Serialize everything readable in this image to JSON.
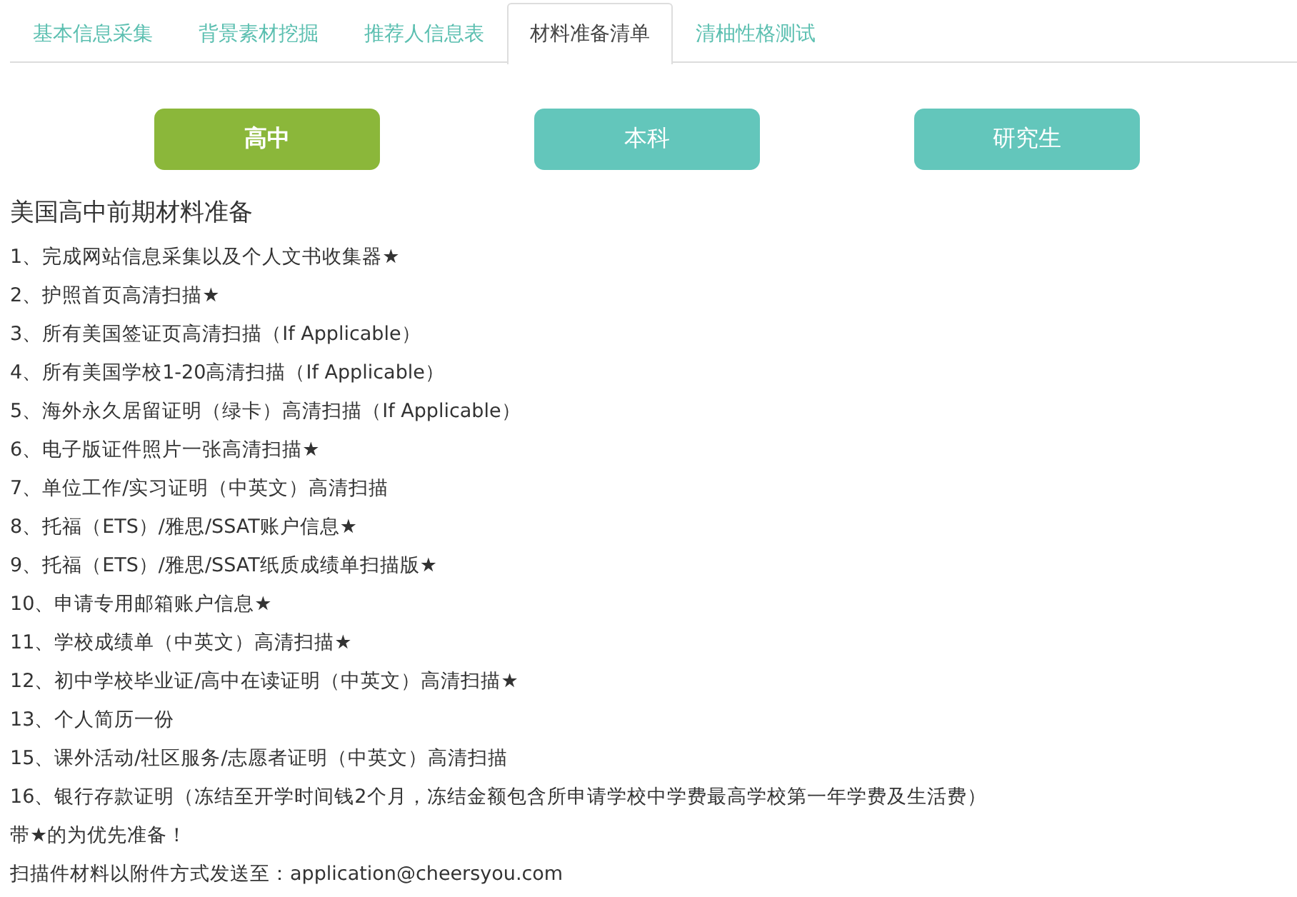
{
  "tabs": [
    {
      "label": "基本信息采集",
      "selected": false
    },
    {
      "label": "背景素材挖掘",
      "selected": false
    },
    {
      "label": "推荐人信息表",
      "selected": false
    },
    {
      "label": "材料准备清单",
      "selected": true
    },
    {
      "label": "清柚性格测试",
      "selected": false
    }
  ],
  "levels": [
    {
      "label": "高中",
      "selected": true
    },
    {
      "label": "本科",
      "selected": false
    },
    {
      "label": "研究生",
      "selected": false
    }
  ],
  "heading": "美国高中前期材料准备",
  "items": [
    "1、完成网站信息采集以及个人文书收集器★",
    "2、护照首页高清扫描★",
    "3、所有美国签证页高清扫描（If Applicable）",
    "4、所有美国学校1-20高清扫描（If Applicable）",
    "5、海外永久居留证明（绿卡）高清扫描（If Applicable）",
    "6、电子版证件照片一张高清扫描★",
    "7、单位工作/实习证明（中英文）高清扫描",
    "8、托福（ETS）/雅思/SSAT账户信息★",
    "9、托福（ETS）/雅思/SSAT纸质成绩单扫描版★",
    "10、申请专用邮箱账户信息★",
    "11、学校成绩单（中英文）高清扫描★",
    "12、初中学校毕业证/高中在读证明（中英文）高清扫描★",
    "13、个人简历一份",
    "15、课外活动/社区服务/志愿者证明（中英文）高清扫描",
    "16、银行存款证明（冻结至开学时间钱2个月，冻结金额包含所申请学校中学费最高学校第一年学费及生活费）"
  ],
  "note": "带★的为优先准备！",
  "send_to": "扫描件材料以附件方式发送至：application@cheersyou.com"
}
